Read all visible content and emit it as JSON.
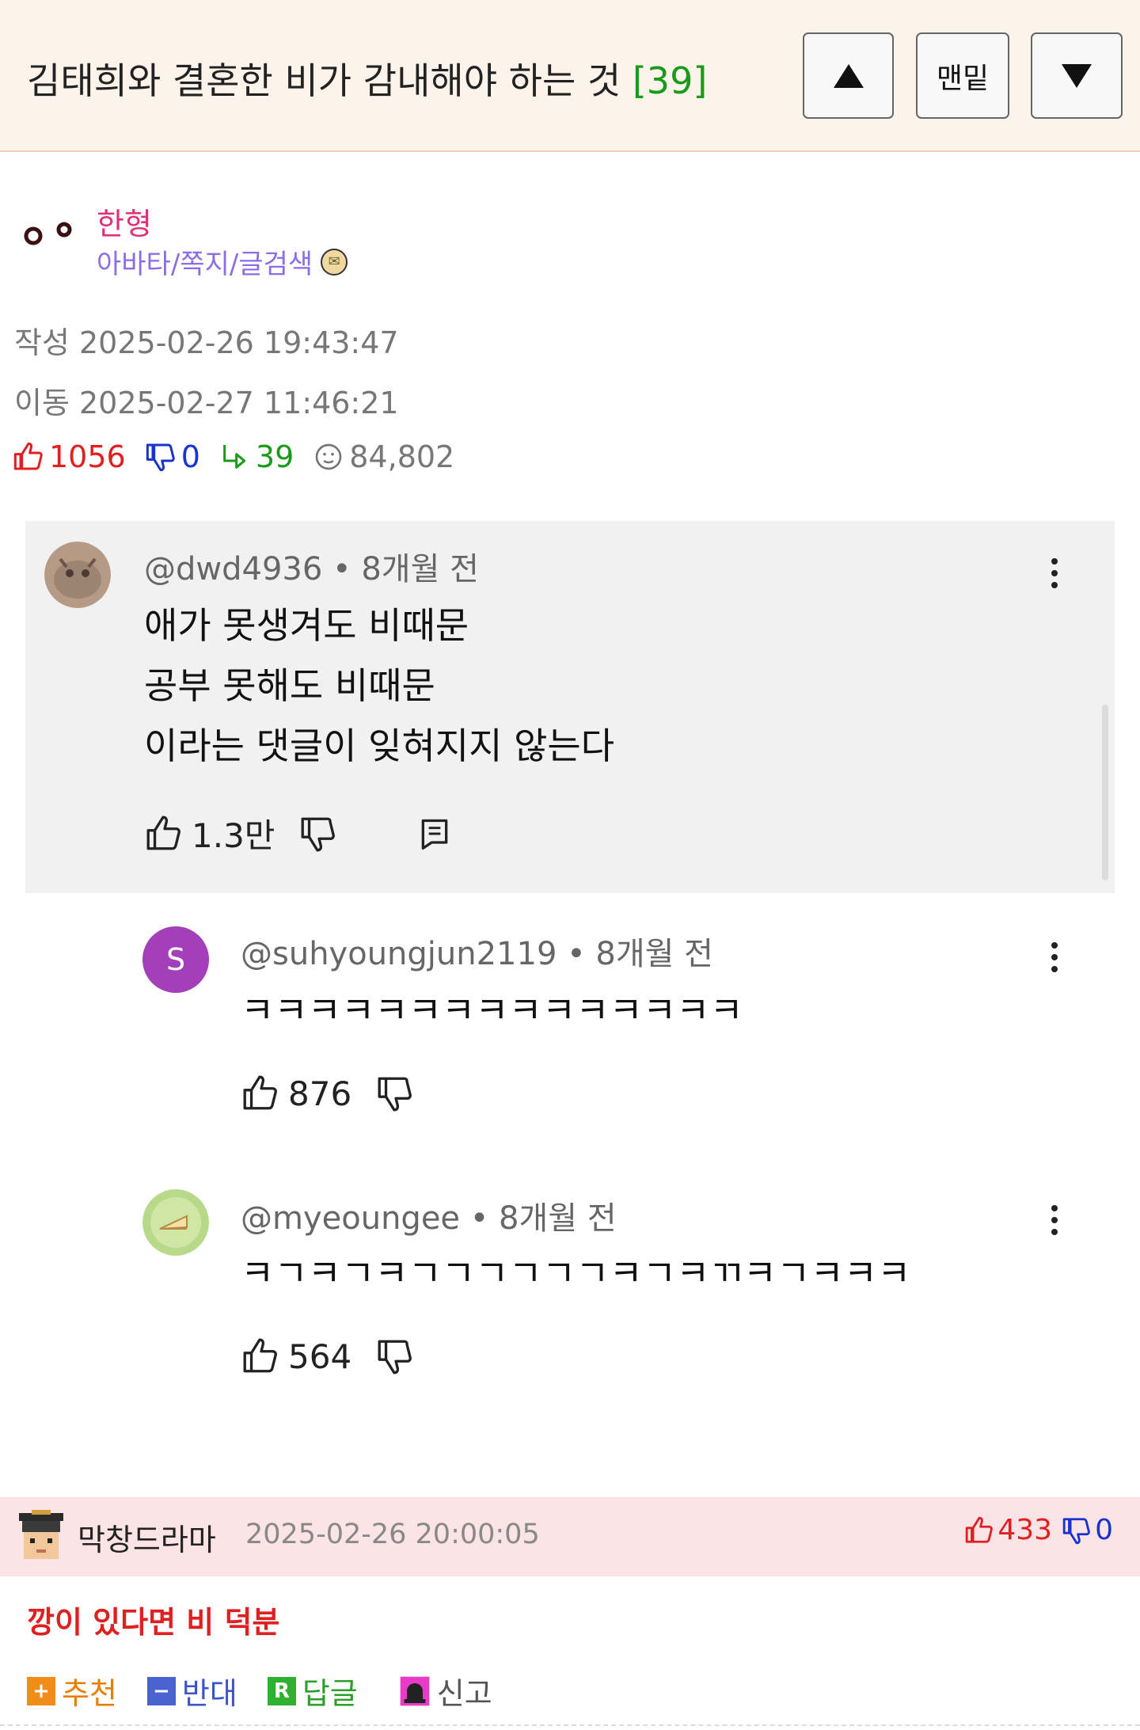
{
  "header": {
    "title": "김태희와 결혼한 비가 감내해야 하는 것",
    "count": "[39]",
    "up_button": "▲",
    "bottom_button": "맨밑",
    "down_button": "▼"
  },
  "author": {
    "name": "한형",
    "links": "아바타/쪽지/글검색"
  },
  "meta": {
    "written": "작성 2025-02-26 19:43:47",
    "moved": "이동 2025-02-27 11:46:21"
  },
  "stats": {
    "likes": "1056",
    "dislikes": "0",
    "replies": "39",
    "views": "84,802"
  },
  "screenshot": {
    "comments": [
      {
        "handle": "@dwd4936 • 8개월 전",
        "lines": [
          "애가 못생겨도 비때문",
          "공부 못해도 비때문",
          "이라는 댓글이 잊혀지지 않는다"
        ],
        "likes": "1.3만"
      },
      {
        "avatar_letter": "S",
        "handle": "@suhyoungjun2119 • 8개월 전",
        "lines": [
          "ㅋㅋㅋㅋㅋㅋㅋㅋㅋㅋㅋㅋㅋㅋㅋ"
        ],
        "likes": "876"
      },
      {
        "handle": "@myeoungee • 8개월 전",
        "lines": [
          "ㅋㄱㅋㄱㅋㄱㄱㄱㄱㄱㄱㅋㄱㅋㄲㅋㄱㅋㅋㅋ"
        ],
        "likes": "564"
      }
    ]
  },
  "reply": {
    "name": "막창드라마",
    "date": "2025-02-26 20:00:05",
    "likes": "433",
    "dislikes": "0",
    "body": "깡이 있다면 비 덕분",
    "actions": {
      "recommend": "추천",
      "oppose": "반대",
      "reply": "답글",
      "report": "신고"
    }
  },
  "colors": {
    "header_bg": "#fcf3ea",
    "author_name": "#e0307a",
    "author_links": "#8a6ee8",
    "like": "#e02020",
    "dislike": "#1a33cc",
    "reply_count": "#1a9a1a",
    "reply_bg": "#fbe3e6"
  }
}
